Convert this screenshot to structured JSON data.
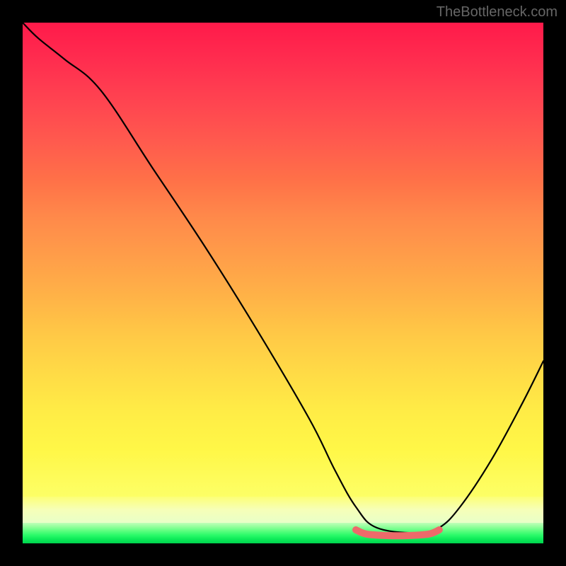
{
  "watermark": "TheBottleneck.com",
  "chart_data": {
    "type": "line",
    "title": "",
    "xlabel": "",
    "ylabel": "",
    "xlim": [
      0,
      100
    ],
    "ylim": [
      0,
      100
    ],
    "background": "red-yellow-green-vertical-gradient",
    "series": [
      {
        "name": "bottleneck-curve",
        "color": "#000000",
        "x": [
          0,
          3,
          8,
          15,
          25,
          35,
          45,
          55,
          60,
          64,
          68,
          76,
          80,
          84,
          90,
          96,
          100
        ],
        "values": [
          100,
          97,
          93,
          87,
          72,
          57,
          41,
          24,
          14,
          7,
          3,
          2,
          3,
          7,
          16,
          27,
          35
        ]
      },
      {
        "name": "optimal-band",
        "color": "#ed6a6a",
        "x": [
          64,
          66,
          70,
          74,
          78,
          80
        ],
        "values": [
          2.6,
          1.8,
          1.5,
          1.5,
          1.8,
          2.6
        ]
      }
    ],
    "annotations": []
  }
}
